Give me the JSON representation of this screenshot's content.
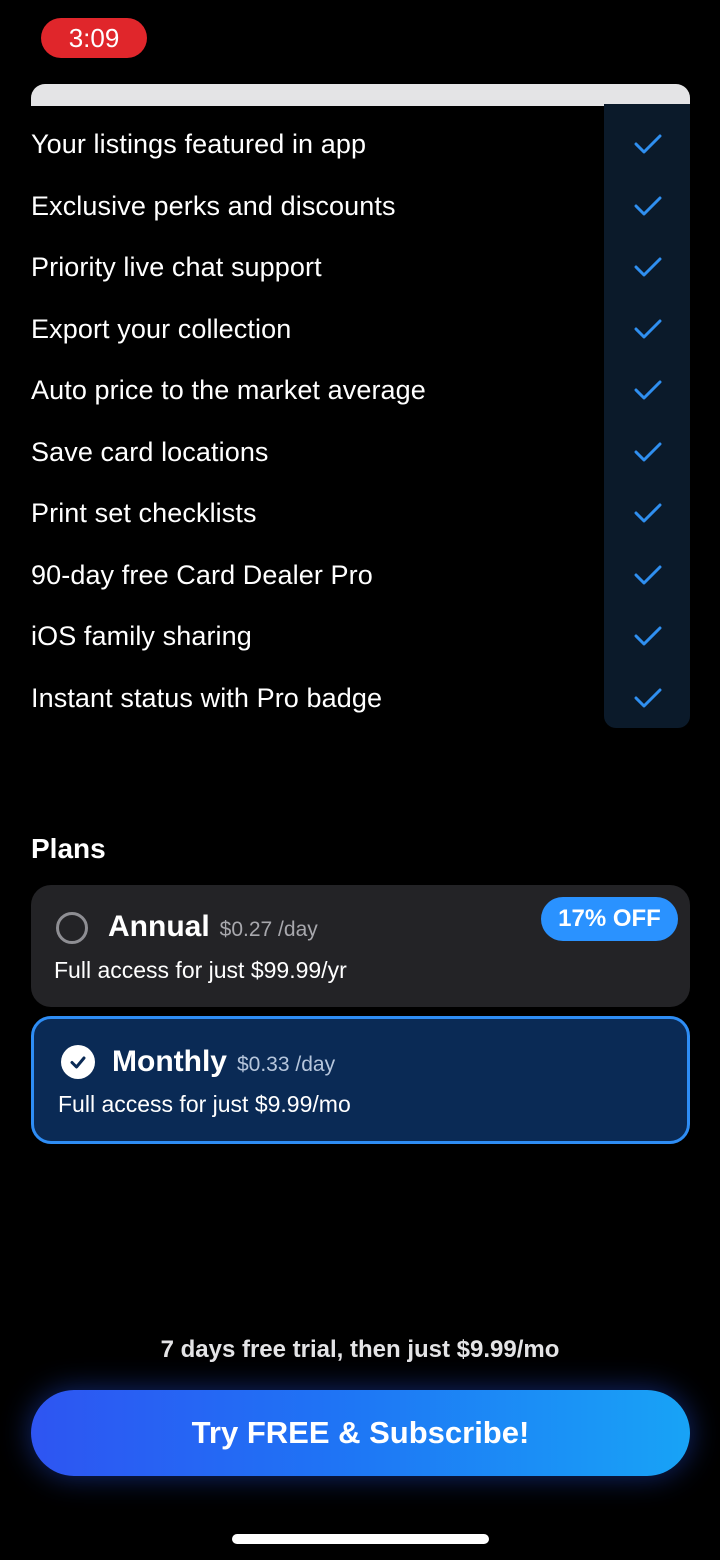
{
  "status_bar": {
    "time": "3:09"
  },
  "features": {
    "items": [
      {
        "label": "Your listings featured in app",
        "icon": "checkmark-icon"
      },
      {
        "label": "Exclusive perks and discounts",
        "icon": "checkmark-icon"
      },
      {
        "label": "Priority live chat support",
        "icon": "checkmark-icon"
      },
      {
        "label": "Export your collection",
        "icon": "checkmark-icon"
      },
      {
        "label": "Auto price to the market average",
        "icon": "checkmark-icon"
      },
      {
        "label": "Save card locations",
        "icon": "checkmark-icon"
      },
      {
        "label": "Print set checklists",
        "icon": "checkmark-icon"
      },
      {
        "label": "90-day free Card Dealer Pro",
        "icon": "checkmark-icon"
      },
      {
        "label": "iOS family sharing",
        "icon": "checkmark-icon"
      },
      {
        "label": "Instant status with Pro badge",
        "icon": "checkmark-icon"
      }
    ]
  },
  "plans": {
    "heading": "Plans",
    "annual": {
      "name": "Annual",
      "per_day": "$0.27 /day",
      "description": "Full access for just $99.99/yr",
      "badge": "17% OFF",
      "selected": false
    },
    "monthly": {
      "name": "Monthly",
      "per_day": "$0.33 /day",
      "description": "Full access for just $9.99/mo",
      "selected": true
    }
  },
  "footer": {
    "trial_text": "7 days free trial, then just $9.99/mo",
    "cta_label": "Try FREE & Subscribe!"
  },
  "colors": {
    "accent": "#2e8df5",
    "selected_card_bg": "#0a2a55",
    "checkmark": "#2f8ff0",
    "status_pill": "#e0262b"
  }
}
